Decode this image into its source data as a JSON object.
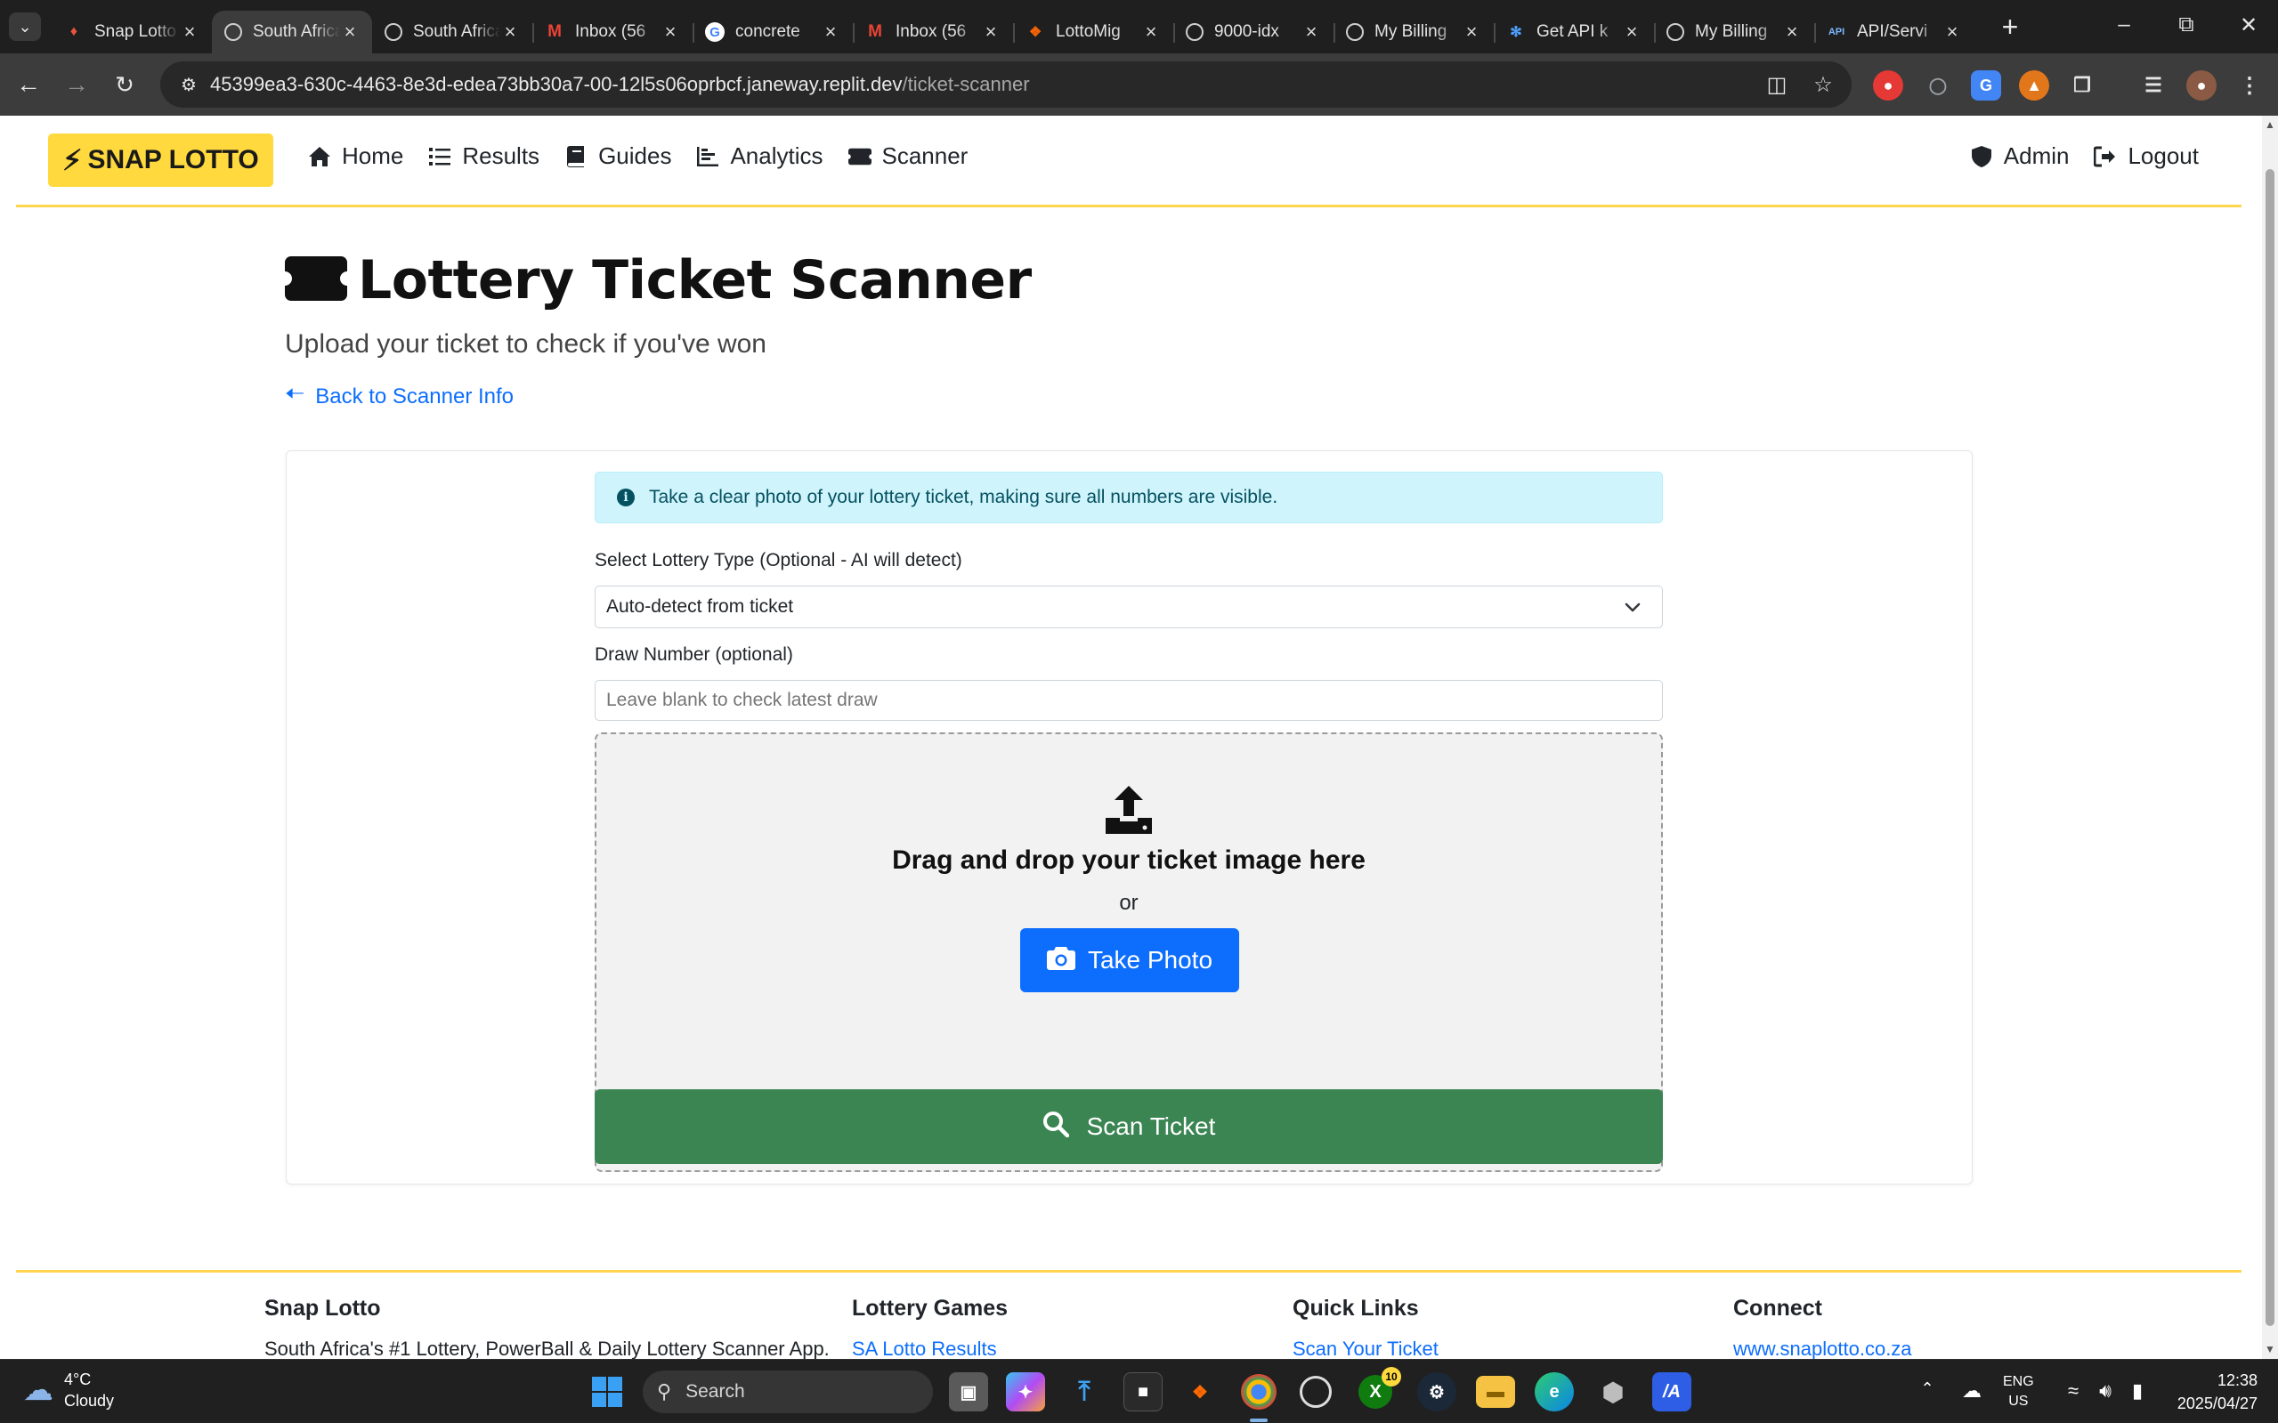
{
  "browser": {
    "tabs": [
      {
        "title": "Snap Lotto",
        "icon": "snap-lotto-favicon",
        "active": false
      },
      {
        "title": "South Africa",
        "icon": "globe-favicon",
        "active": true
      },
      {
        "title": "South Africa",
        "icon": "globe-favicon",
        "active": false
      },
      {
        "title": "Inbox (56",
        "icon": "gmail-favicon",
        "active": false
      },
      {
        "title": "concrete",
        "icon": "google-favicon",
        "active": false
      },
      {
        "title": "Inbox (56",
        "icon": "gmail-favicon",
        "active": false
      },
      {
        "title": "LottoMig",
        "icon": "replit-favicon",
        "active": false
      },
      {
        "title": "9000-idx",
        "icon": "globe-favicon",
        "active": false
      },
      {
        "title": "My Billing",
        "icon": "github-favicon",
        "active": false
      },
      {
        "title": "Get API k",
        "icon": "atom-favicon",
        "active": false
      },
      {
        "title": "My Billing",
        "icon": "github-favicon",
        "active": false
      },
      {
        "title": "API/Servi",
        "icon": "api-favicon",
        "active": false
      }
    ],
    "url_host": "45399ea3-630c-4463-8e3d-edea73bb30a7-00-12l5s06oprbcf.janeway.replit.dev",
    "url_path": "/ticket-scanner"
  },
  "nav": {
    "brand": "SNAP LOTTO",
    "links": [
      {
        "label": "Home",
        "icon": "home-icon"
      },
      {
        "label": "Results",
        "icon": "list-icon"
      },
      {
        "label": "Guides",
        "icon": "book-icon"
      },
      {
        "label": "Analytics",
        "icon": "chart-icon"
      },
      {
        "label": "Scanner",
        "icon": "ticket-icon"
      }
    ],
    "admin": "Admin",
    "logout": "Logout"
  },
  "page": {
    "title": "Lottery Ticket Scanner",
    "subtitle": "Upload your ticket to check if you've won",
    "back_link": "Back to Scanner Info"
  },
  "form": {
    "alert": "Take a clear photo of your lottery ticket, making sure all numbers are visible.",
    "lottery_type_label": "Select Lottery Type (Optional - AI will detect)",
    "lottery_type_value": "Auto-detect from ticket",
    "draw_label": "Draw Number (optional)",
    "draw_placeholder": "Leave blank to check latest draw",
    "dropzone_text": "Drag and drop your ticket image here",
    "dropzone_or": "or",
    "take_photo": "Take Photo",
    "scan_button": "Scan Ticket"
  },
  "footer": {
    "col1_title": "Snap Lotto",
    "col1_text": "South Africa's #1 Lottery, PowerBall & Daily Lottery Scanner App.",
    "col2_title": "Lottery Games",
    "col2_link": "SA Lotto Results",
    "col3_title": "Quick Links",
    "col3_link": "Scan Your Ticket",
    "col4_title": "Connect",
    "col4_link": "www.snaplotto.co.za"
  },
  "taskbar": {
    "temperature": "4°C",
    "weather": "Cloudy",
    "search": "Search",
    "xbox_badge": "10",
    "lang": "ENG",
    "region": "US",
    "time": "12:38",
    "date": "2025/04/27"
  },
  "colors": {
    "brand_yellow": "#ffd93d",
    "primary_blue": "#0d6efd",
    "scan_green": "#3b8553",
    "alert_bg": "#cff4fc"
  }
}
